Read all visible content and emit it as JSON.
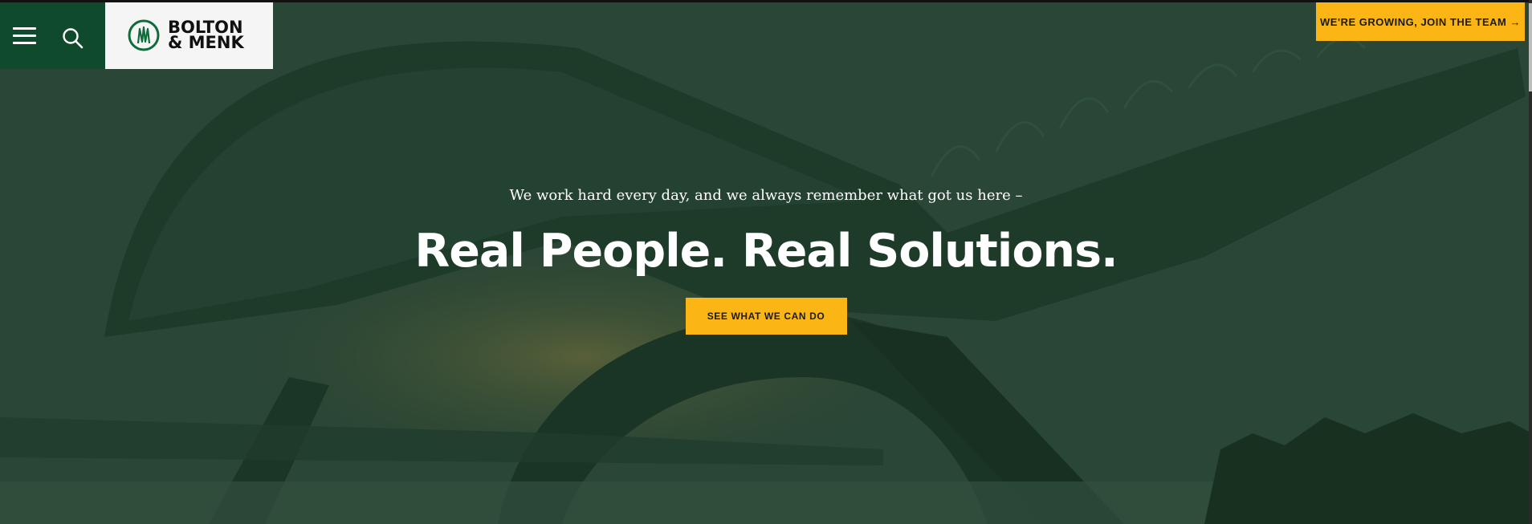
{
  "header": {
    "menu_icon": "hamburger-menu-icon",
    "search_icon": "search-icon",
    "logo": {
      "line1": "BOLTON",
      "line2": "& MENK",
      "mark_icon": "bolton-menk-logo-mark"
    },
    "join_button_label": "WE'RE GROWING, JOIN THE TEAM →"
  },
  "hero": {
    "tagline": "We work hard every day, and we always remember what got us here –",
    "headline": "Real People. Real Solutions.",
    "cta_label": "SEE WHAT WE CAN DO"
  },
  "colors": {
    "brand_green": "#0f4a2c",
    "accent_yellow": "#fbb615",
    "overlay_green": "#24402f"
  }
}
